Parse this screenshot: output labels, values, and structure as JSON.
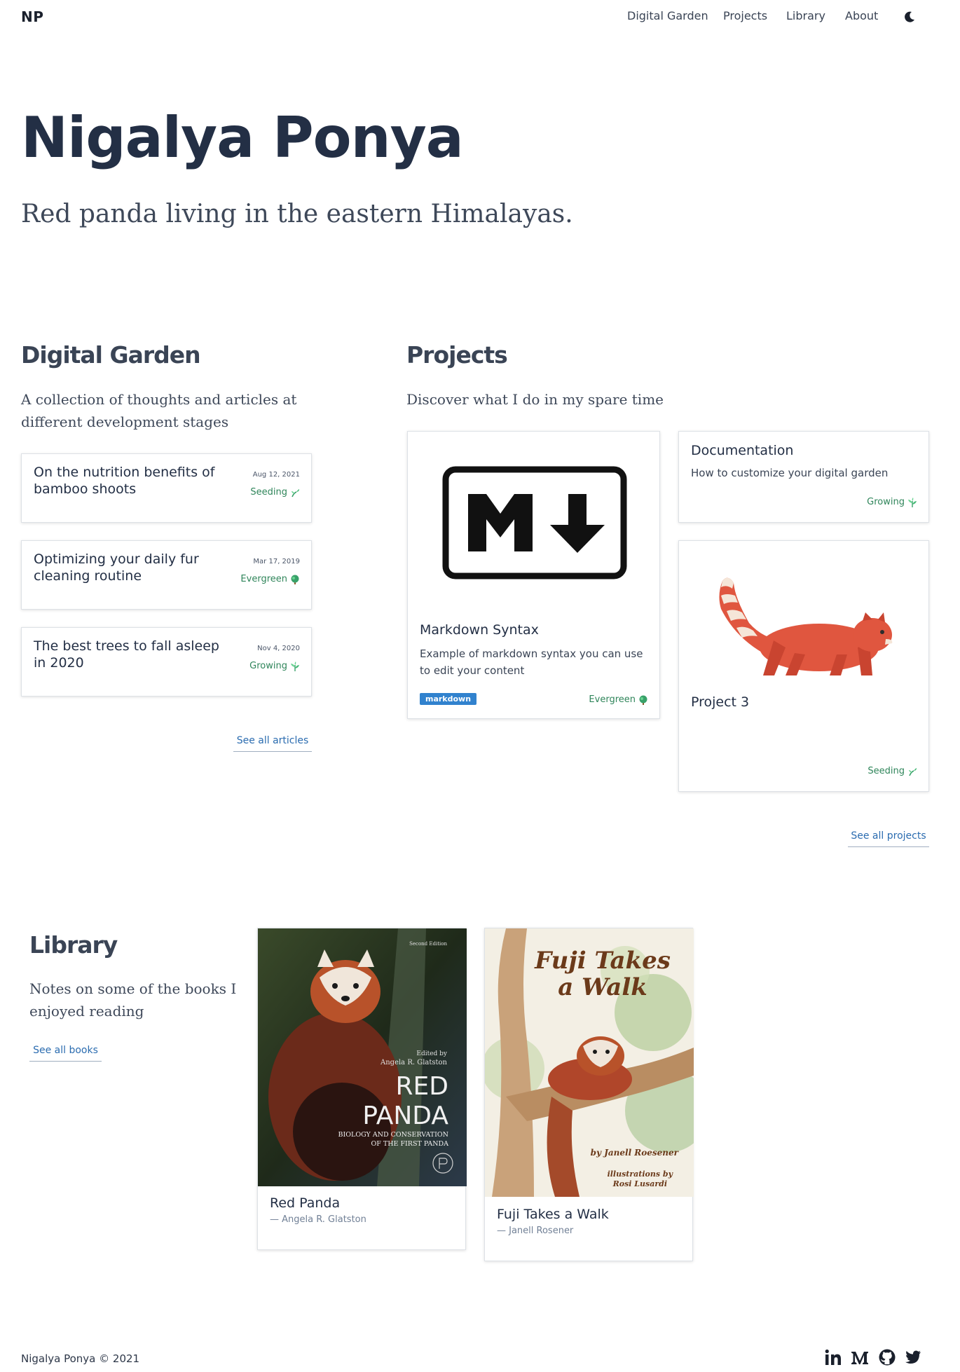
{
  "header": {
    "logo": "NP",
    "nav": [
      "Digital Garden",
      "Projects",
      "Library",
      "About"
    ],
    "theme_toggle_icon": "moon-icon"
  },
  "hero": {
    "title": "Nigalya Ponya",
    "subtitle": "Red panda living in the eastern Himalayas."
  },
  "garden": {
    "title": "Digital Garden",
    "description": "A collection of thoughts and articles at different development stages",
    "notes": [
      {
        "title": "On the nutrition benefits of bamboo shoots",
        "date": "Aug 12, 2021",
        "stage": "Seeding",
        "icon": "seedling-icon"
      },
      {
        "title": "Optimizing your daily fur cleaning routine",
        "date": "Mar 17, 2019",
        "stage": "Evergreen",
        "icon": "tree-icon"
      },
      {
        "title": "The best trees to fall asleep in 2020",
        "date": "Nov 4, 2020",
        "stage": "Growing",
        "icon": "herb-icon"
      }
    ],
    "see_all": "See all articles"
  },
  "projects": {
    "title": "Projects",
    "description": "Discover what I do in my spare time",
    "items": [
      {
        "title": "Markdown Syntax",
        "description": "Example of markdown syntax you can use to edit your content",
        "tag": "markdown",
        "stage": "Evergreen",
        "image": "markdown-logo"
      },
      {
        "title": "Documentation",
        "description": "How to customize your digital garden",
        "stage": "Growing"
      },
      {
        "title": "Project 3",
        "stage": "Seeding",
        "image": "red-panda-illustration"
      }
    ],
    "see_all": "See all projects"
  },
  "library": {
    "title": "Library",
    "description": "Notes on some of the books I enjoyed reading",
    "see_all": "See all books",
    "books": [
      {
        "title": "Red Panda",
        "author": "— Angela R. Glatston",
        "cover_title_1": "RED",
        "cover_title_2": "PANDA",
        "cover_subtitle_1": "BIOLOGY AND CONSERVATION",
        "cover_subtitle_2": "OF THE FIRST PANDA",
        "cover_author": "Angela R. Glatston",
        "cover_edition": "Second Edition",
        "cover_edited_by": "Edited by"
      },
      {
        "title": "Fuji Takes a Walk",
        "author": "— Janell Rosener",
        "cover_title_1": "Fuji Takes",
        "cover_title_2": "a Walk",
        "cover_by": "by Janell Roesener",
        "cover_illus_1": "illustrations by",
        "cover_illus_2": "Rosi Lusardi"
      }
    ]
  },
  "footer": {
    "copyright": "Nigalya Ponya © 2021",
    "social": [
      "linkedin-icon",
      "medium-icon",
      "github-icon",
      "twitter-icon"
    ]
  },
  "colors": {
    "accent": "#2b6cb0",
    "stage_green": "#2f855a",
    "heading": "#232f45"
  }
}
